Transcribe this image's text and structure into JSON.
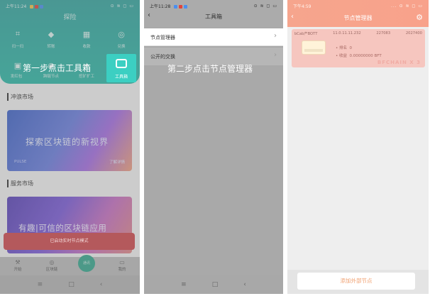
{
  "phone1": {
    "status": {
      "time": "上午11:24",
      "icons_right": "⊙ ≋ ◻ ▭"
    },
    "app_title": "探险",
    "grid": [
      {
        "label": "扫一扫",
        "icon": "scan-icon",
        "glyph": "⌗"
      },
      {
        "label": "转账",
        "icon": "shield-icon",
        "glyph": "◆"
      },
      {
        "label": "收款",
        "icon": "qrcode-icon",
        "glyph": "▦"
      },
      {
        "label": "兑换",
        "icon": "exchange-icon",
        "glyph": "◎"
      },
      {
        "label": "发红包",
        "icon": "redpacket-icon",
        "glyph": "▣"
      },
      {
        "label": "跨链节点",
        "icon": "node-icon",
        "glyph": "◉"
      },
      {
        "label": "挖矿扩工",
        "icon": "mining-icon",
        "glyph": "✦"
      },
      {
        "label": "工具箱",
        "icon": "toolbox-icon",
        "glyph": ""
      }
    ],
    "step_caption": "第一步点击工具箱",
    "section1_title": "冲浪市场",
    "banner1": {
      "title": "探索区块链的新视界",
      "link": "了解详情",
      "sub": "PULSE"
    },
    "section2_title": "服务市场",
    "banner2": {
      "title": "有趣|可信的区块链应用"
    },
    "toast": "已启动实时节点模式",
    "tabs": [
      {
        "label": "开始",
        "glyph": "⚒"
      },
      {
        "label": "区块链",
        "glyph": "◎"
      },
      {
        "label": "通讯",
        "glyph": ""
      },
      {
        "label": "我的",
        "glyph": "▭"
      }
    ],
    "nav": [
      "≡",
      "□",
      "‹"
    ]
  },
  "phone2": {
    "status": {
      "time": "上午11:28",
      "icons_right": "⊙ ≋ ◻ ▭"
    },
    "back": "‹",
    "title": "工具箱",
    "rows": [
      {
        "label": "节点管理器",
        "chevron": "›"
      },
      {
        "label": "公开的交换",
        "chevron": "›"
      }
    ],
    "step_caption": "第二步点击节点管理器",
    "nav": [
      "≡",
      "□",
      "‹"
    ]
  },
  "phone3": {
    "status": {
      "time": "下午4:59",
      "icons_right": "... ⊙ ≋ ◻ ▭"
    },
    "back": "‹",
    "title": "节点管理器",
    "gear": "⚙",
    "card": {
      "name": "bCab产BOTT",
      "ip": "11.0.11.11.232",
      "id": "227083",
      "port": "2027400",
      "height_label": "• 排名",
      "height_value": "0",
      "balance_label": "• 收益",
      "balance_value": "0.00000000 BFT",
      "watermark": "BFCHAIN X 3"
    },
    "add_button": "添加外部节点"
  }
}
